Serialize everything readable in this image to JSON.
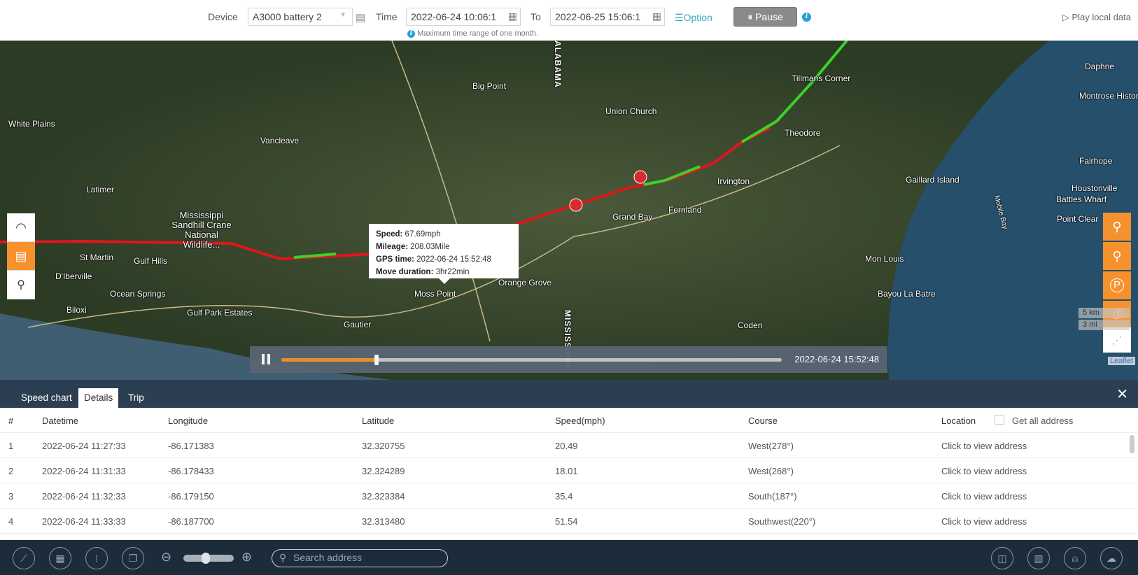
{
  "topbar": {
    "device_label": "Device",
    "device_value": "A3000 battery 2",
    "time_label": "Time",
    "time_from": "2022-06-24 10:06:1",
    "to_label": "To",
    "time_to": "2022-06-25 15:06:1",
    "hint": "Maximum time range of one month.",
    "option_label": "Option",
    "pause_label": "Pause",
    "play_local": "Play local data"
  },
  "map": {
    "places": [
      "White Plains",
      "Vancleave",
      "Latimer",
      "Mississippi Sandhill Crane National Wildlife...",
      "St Martin",
      "Gulf Hills",
      "D'Iberville",
      "Ocean Springs",
      "Biloxi",
      "Gulf Park Estates",
      "Gautier",
      "Moss Point",
      "Big Point",
      "Orange Grove",
      "Union Church",
      "Grand Bay",
      "Fernland",
      "Irvington",
      "Theodore",
      "Tillmans Corner",
      "Gaillard Island",
      "Mon Louis",
      "Bayou La Batre",
      "Coden",
      "Daphne",
      "Montrose Historic District",
      "Fairhope",
      "Houstonville",
      "Battles Wharf",
      "Point Clear",
      "Mobile Bay",
      "ALABAMA",
      "MISSISSIPPI"
    ],
    "popup": {
      "speed_label": "Speed:",
      "speed": "67.69mph",
      "mileage_label": "Mileage:",
      "mileage": "208.03Mile",
      "gps_label": "GPS time:",
      "gps_time": "2022-06-24 15:52:48",
      "move_label": "Move duration:",
      "move": "3hr22min"
    },
    "scale_km": "5 km",
    "scale_mi": "3 mi",
    "attribution": "Leaflet",
    "route_colors": {
      "fast": "#e0161b",
      "slow": "#3ad12b"
    }
  },
  "playback": {
    "progress": 0.19,
    "time": "2022-06-24 15:52:48"
  },
  "panel": {
    "tabs": [
      "Speed chart",
      "Details",
      "Trip"
    ],
    "active_tab": "Details",
    "columns": [
      "#",
      "Datetime",
      "Longitude",
      "Latitude",
      "Speed(mph)",
      "Course",
      "Location"
    ],
    "get_all": "Get all address",
    "rows": [
      [
        "1",
        "2022-06-24 11:27:33",
        "-86.171383",
        "32.320755",
        "20.49",
        "West(278°)",
        "Click to view address"
      ],
      [
        "2",
        "2022-06-24 11:31:33",
        "-86.178433",
        "32.324289",
        "18.01",
        "West(268°)",
        "Click to view address"
      ],
      [
        "3",
        "2022-06-24 11:32:33",
        "-86.179150",
        "32.323384",
        "35.4",
        "South(187°)",
        "Click to view address"
      ],
      [
        "4",
        "2022-06-24 11:33:33",
        "-86.187700",
        "32.313480",
        "51.54",
        "Southwest(220°)",
        "Click to view address"
      ]
    ]
  },
  "bottombar": {
    "search_placeholder": "Search address",
    "zoom_level": 0.45
  },
  "colors": {
    "accent": "#f6922e",
    "panel": "#2c3e52",
    "toolbar": "#1c2c3b",
    "link": "#3aa9c8"
  }
}
